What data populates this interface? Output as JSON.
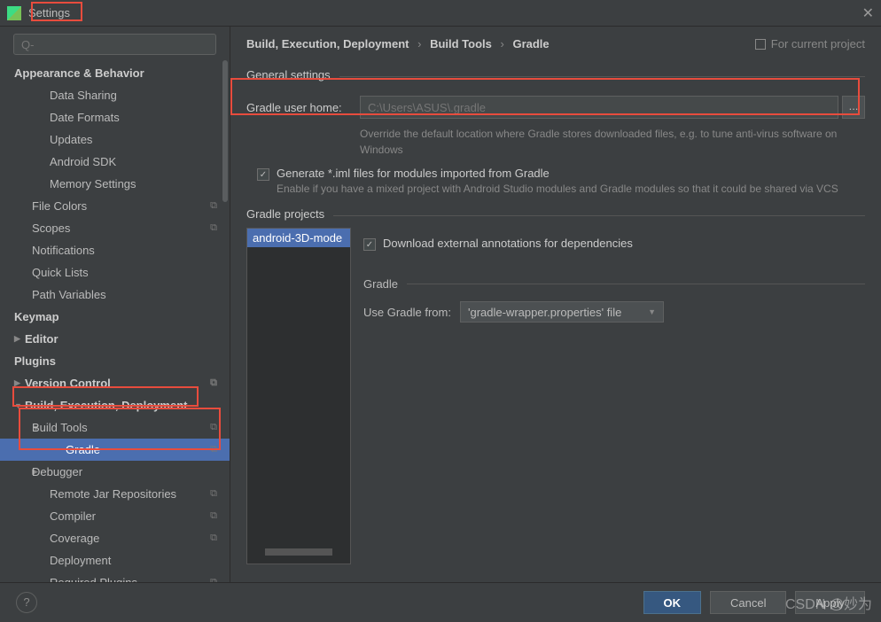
{
  "window": {
    "title": "Settings",
    "close": "✕"
  },
  "search": {
    "placeholder": "Q-"
  },
  "tree": {
    "appearance": "Appearance & Behavior",
    "data_sharing": "Data Sharing",
    "date_formats": "Date Formats",
    "updates": "Updates",
    "android_sdk": "Android SDK",
    "memory": "Memory Settings",
    "file_colors": "File Colors",
    "scopes": "Scopes",
    "notifications": "Notifications",
    "quick_lists": "Quick Lists",
    "path_vars": "Path Variables",
    "keymap": "Keymap",
    "editor": "Editor",
    "plugins": "Plugins",
    "version_control": "Version Control",
    "bed": "Build, Execution, Deployment",
    "build_tools": "Build Tools",
    "gradle": "Gradle",
    "debugger": "Debugger",
    "remote_jar": "Remote Jar Repositories",
    "compiler": "Compiler",
    "coverage": "Coverage",
    "deployment": "Deployment",
    "required_plugins": "Required Plugins",
    "badge": "⧉"
  },
  "breadcrumb": {
    "p1": "Build, Execution, Deployment",
    "p2": "Build Tools",
    "p3": "Gradle",
    "sep": "›"
  },
  "for_project": "For current project",
  "general": {
    "title": "General settings",
    "home_label": "Gradle user home:",
    "home_placeholder": "C:\\Users\\ASUS\\.gradle",
    "browse": "...",
    "hint": "Override the default location where Gradle stores downloaded files, e.g. to tune anti-virus software on Windows",
    "iml_label": "Generate *.iml files for modules imported from Gradle",
    "iml_hint": "Enable if you have a mixed project with Android Studio modules and Gradle modules so that it could be shared via VCS"
  },
  "projects": {
    "title": "Gradle projects",
    "item": "android-3D-mode",
    "download_label": "Download external annotations for dependencies",
    "gradle_title": "Gradle",
    "use_from_label": "Use Gradle from:",
    "use_from_value": "'gradle-wrapper.properties' file"
  },
  "footer": {
    "help": "?",
    "ok": "OK",
    "cancel": "Cancel",
    "apply": "Apply"
  },
  "watermark": "CSDN @妙为"
}
